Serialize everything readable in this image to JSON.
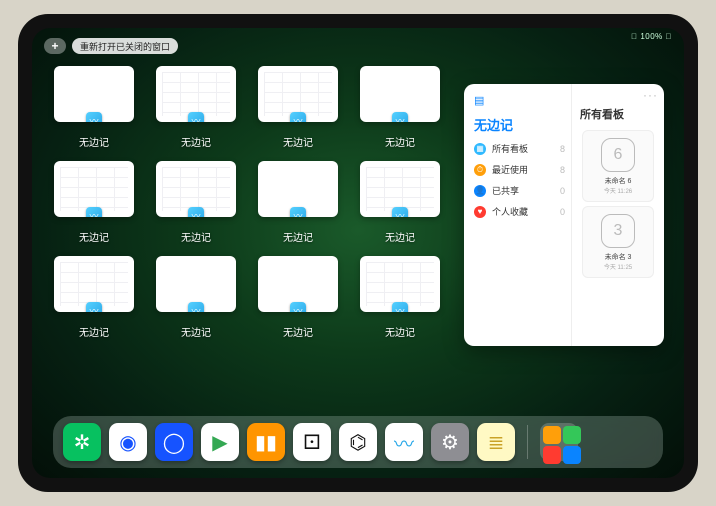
{
  "status": {
    "text": "􀙇 100% 􀛨"
  },
  "topbar": {
    "add_label": "+",
    "reopen_label": "重新打开已关闭的窗口"
  },
  "windows": [
    {
      "label": "无边记",
      "detailed": false
    },
    {
      "label": "无边记",
      "detailed": true
    },
    {
      "label": "无边记",
      "detailed": true
    },
    {
      "label": "无边记",
      "detailed": false
    },
    {
      "label": "无边记",
      "detailed": true
    },
    {
      "label": "无边记",
      "detailed": true
    },
    {
      "label": "无边记",
      "detailed": false
    },
    {
      "label": "无边记",
      "detailed": true
    },
    {
      "label": "无边记",
      "detailed": true
    },
    {
      "label": "无边记",
      "detailed": false
    },
    {
      "label": "无边记",
      "detailed": false
    },
    {
      "label": "无边记",
      "detailed": true
    }
  ],
  "panel": {
    "app_title": "无边记",
    "right_title": "所有看板",
    "more": "···",
    "categories": [
      {
        "label": "所有看板",
        "count": "8",
        "color": "#2fb9ff",
        "glyph": "▦"
      },
      {
        "label": "最近使用",
        "count": "8",
        "color": "#ff9f0a",
        "glyph": "⏱"
      },
      {
        "label": "已共享",
        "count": "0",
        "color": "#0a84ff",
        "glyph": "👤"
      },
      {
        "label": "个人收藏",
        "count": "0",
        "color": "#ff3b30",
        "glyph": "♥"
      }
    ],
    "boards": [
      {
        "sketch": "6",
        "name": "未命名 6",
        "time": "今天 11:26"
      },
      {
        "sketch": "3",
        "name": "未命名 3",
        "time": "今天 11:25"
      }
    ]
  },
  "dock": {
    "apps": [
      {
        "name": "wechat",
        "bg": "#07c160",
        "glyph": "✲"
      },
      {
        "name": "quark-hd",
        "bg": "#ffffff",
        "glyph": "◉",
        "fg": "#1653ff"
      },
      {
        "name": "quark",
        "bg": "#1653ff",
        "glyph": "◯"
      },
      {
        "name": "play",
        "bg": "#ffffff",
        "glyph": "▶",
        "fg": "#34a853"
      },
      {
        "name": "books",
        "bg": "#ff9500",
        "glyph": "▮▮"
      },
      {
        "name": "dice",
        "bg": "#ffffff",
        "glyph": "⚀",
        "fg": "#111"
      },
      {
        "name": "nodes",
        "bg": "#ffffff",
        "glyph": "⌬",
        "fg": "#111"
      },
      {
        "name": "freeform",
        "bg": "#ffffff",
        "glyph": "〰",
        "fg": "#2aa8e8"
      },
      {
        "name": "settings",
        "bg": "#8e8e93",
        "glyph": "⚙"
      },
      {
        "name": "notes",
        "bg": "#fff9c4",
        "glyph": "≣",
        "fg": "#c9a227"
      }
    ],
    "recents": [
      {
        "bg": "#ff9f0a"
      },
      {
        "bg": "#34c759"
      },
      {
        "bg": "#ff3b30"
      },
      {
        "bg": "#0a84ff"
      }
    ]
  }
}
